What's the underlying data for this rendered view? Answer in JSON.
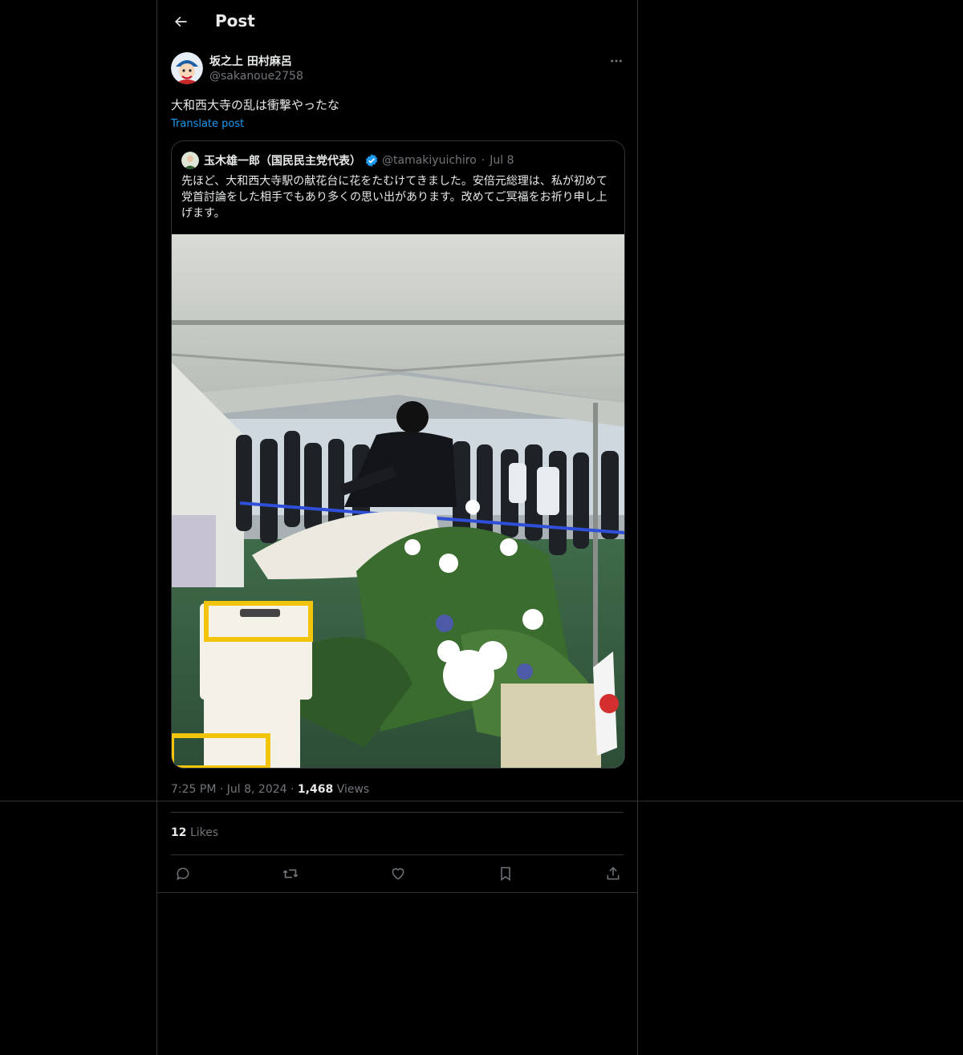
{
  "header": {
    "title": "Post"
  },
  "post": {
    "author_name": "坂之上 田村麻呂",
    "author_handle": "@sakanoue2758",
    "text": "大和西大寺の乱は衝撃やったな",
    "translate_label": "Translate post",
    "time": "7:25 PM",
    "date": "Jul 8, 2024",
    "views_count": "1,468",
    "views_label": "Views",
    "likes_count": "12",
    "likes_label": "Likes"
  },
  "quote": {
    "author_name": "玉木雄一郎（国民民主党代表）",
    "author_handle": "@tamakiyuichiro",
    "date": "Jul 8",
    "text": "先ほど、大和西大寺駅の献花台に花をたむけてきました。安倍元総理は、私が初めて党首討論をした相手でもあり多くの思い出があります。改めてご冥福をお祈り申し上げます。",
    "verified": true
  },
  "actions": [
    "reply-icon",
    "repost-icon",
    "like-icon",
    "bookmark-icon",
    "share-icon"
  ],
  "colors": {
    "accent": "#1d9bf0",
    "muted": "#71767b",
    "border": "#2f3336"
  },
  "separator": "·"
}
